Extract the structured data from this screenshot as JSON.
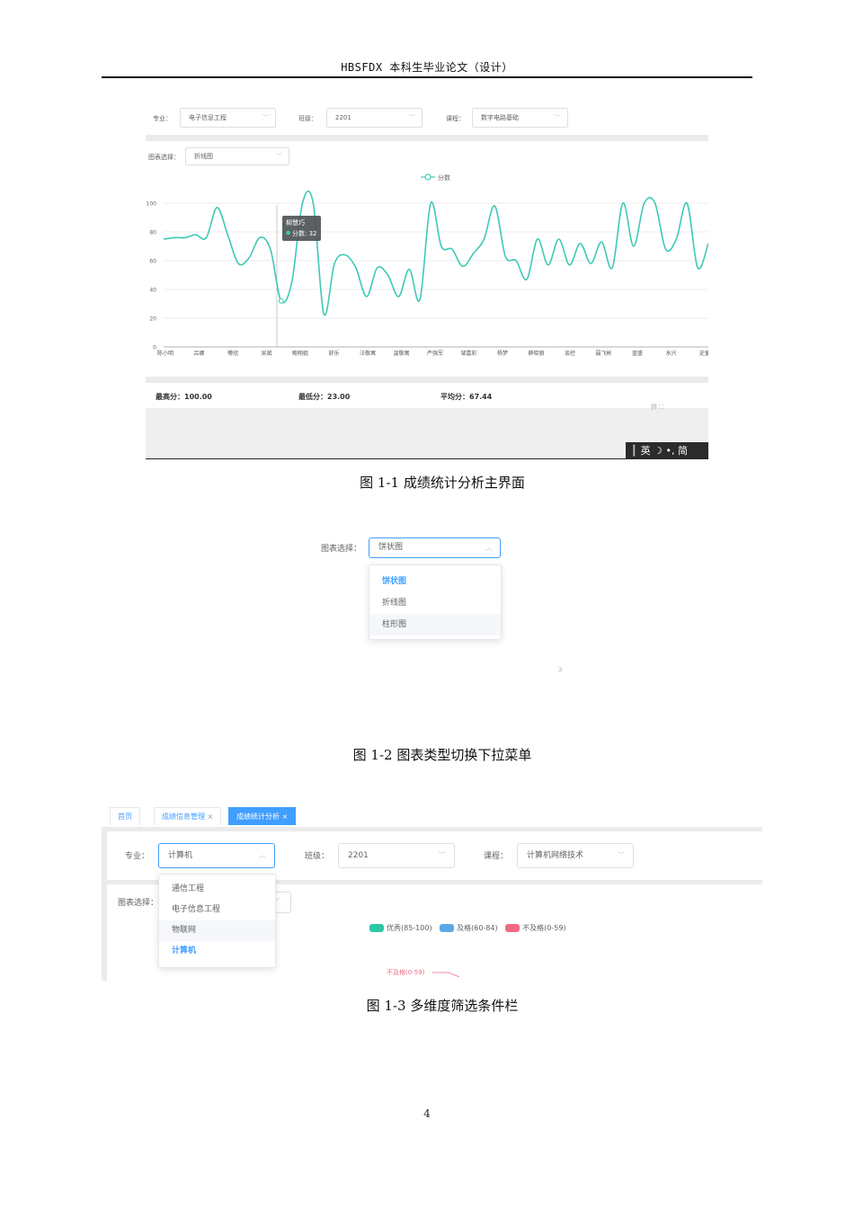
{
  "header": {
    "title": "HBSFDX 本科生毕业论文（设计）"
  },
  "page_number": "4",
  "figure1": {
    "caption": "图 1-1  成绩统计分析主界面",
    "filters": {
      "major_label": "专业：",
      "major_value": "电子信息工程",
      "class_label": "班级：",
      "class_value": "2201",
      "course_label": "课程：",
      "course_value": "数字电路基础"
    },
    "chart_type_label": "图表选择：",
    "chart_type_value": "折线图",
    "tooltip": {
      "name": "柳慧巧",
      "label": "分数: 32"
    },
    "stats": {
      "max": "最高分：100.00",
      "min": "最低分：23.00",
      "avg": "平均分：67.44"
    },
    "ime": {
      "text": "英 ☽ •, 简"
    },
    "corner_hint": "拼 ⛶",
    "colors": {
      "line": "#3ec9b5",
      "grid": "#e6e6e6",
      "band": "#ebebeb",
      "ime_bg": "#2b2b2b"
    }
  },
  "chart_data": {
    "type": "line",
    "title": "",
    "legend": [
      "分数"
    ],
    "legend_position": "top-center",
    "grid": true,
    "ylim": [
      0,
      100
    ],
    "yticks": [
      0,
      20,
      40,
      60,
      80,
      100
    ],
    "xlabel": "",
    "ylabel": "",
    "xtick_labels": [
      "陈小明",
      "吕娜",
      "傅冠",
      "吴斌",
      "鲍翔姐",
      "舒乐",
      "汪敬寓",
      "温敬寓",
      "严强军",
      "邹嘉彩",
      "杨梦",
      "薛晓丽",
      "谈控",
      "聂飞彬",
      "蓝盛",
      "水兴",
      "史童"
    ],
    "series": [
      {
        "name": "分数",
        "values": [
          75,
          76,
          76,
          78,
          76,
          97,
          78,
          58,
          62,
          76,
          68,
          32,
          45,
          100,
          100,
          23,
          58,
          64,
          55,
          35,
          55,
          50,
          35,
          54,
          33,
          100,
          70,
          68,
          56,
          65,
          75,
          98,
          63,
          60,
          47,
          75,
          57,
          75,
          57,
          72,
          58,
          73,
          55,
          100,
          70,
          100,
          100,
          68,
          75,
          100,
          55,
          72
        ]
      }
    ]
  },
  "figure2": {
    "caption": "图 1-2  图表类型切换下拉菜单",
    "label": "图表选择：",
    "value": "饼状图",
    "options": [
      "饼状图",
      "折线图",
      "柱形图"
    ],
    "selected_index": 0,
    "hover_index": 2,
    "stray_mark": "ↄ"
  },
  "figure3": {
    "caption": "图 1-3  多维度筛选条件栏",
    "tabs": [
      {
        "label": "首页",
        "closable": false
      },
      {
        "label": "成绩信息管理",
        "closable": true
      },
      {
        "label": "成绩统计分析",
        "closable": true
      }
    ],
    "active_tab": 2,
    "close_glyph": "×",
    "major_label": "专业：",
    "major_value": "计算机",
    "class_label": "班级：",
    "class_value": "2201",
    "course_label": "课程：",
    "course_value": "计算机网络技术",
    "chart_label": "图表选择：",
    "major_options": [
      "通信工程",
      "电子信息工程",
      "物联网",
      "计算机"
    ],
    "selected_index": 3,
    "hover_index": 2,
    "legend": [
      {
        "label": "优秀(85-100)",
        "color": "#2ec7a6"
      },
      {
        "label": "及格(60-84)",
        "color": "#5aa9e6"
      },
      {
        "label": "不及格(0-59)",
        "color": "#ee6a83"
      }
    ],
    "pie_label": "不及格(0-59)"
  }
}
